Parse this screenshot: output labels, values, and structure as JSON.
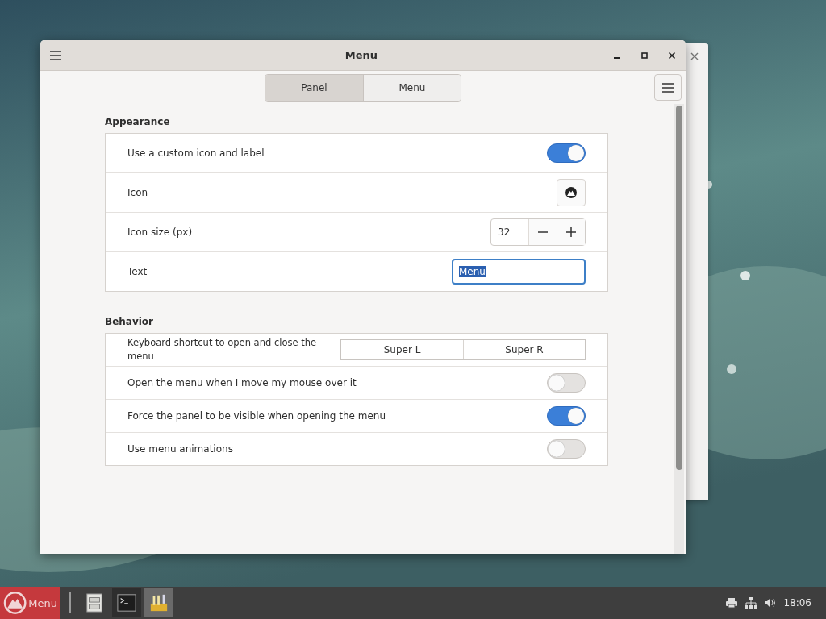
{
  "window": {
    "title": "Menu"
  },
  "tabs": [
    {
      "label": "Panel",
      "selected": true
    },
    {
      "label": "Menu",
      "selected": false
    }
  ],
  "sections": [
    {
      "title": "Appearance",
      "rows": [
        {
          "kind": "switch",
          "label": "Use a custom icon and label",
          "on": true
        },
        {
          "kind": "icon",
          "label": "Icon"
        },
        {
          "kind": "spin",
          "label": "Icon size (px)",
          "value": "32"
        },
        {
          "kind": "entry",
          "label": "Text",
          "value": "Menu",
          "text_selected": true
        }
      ]
    },
    {
      "title": "Behavior",
      "rows": [
        {
          "kind": "shortcut",
          "label": "Keyboard shortcut to open and close the menu",
          "keys": [
            "Super L",
            "Super R"
          ]
        },
        {
          "kind": "switch",
          "label": "Open the menu when I move my mouse over it",
          "on": false
        },
        {
          "kind": "switch",
          "label": "Force the panel to be visible when opening the menu",
          "on": true
        },
        {
          "kind": "switch",
          "label": "Use menu animations",
          "on": false
        }
      ]
    }
  ],
  "taskbar": {
    "menu_label": "Menu",
    "clock": "18:06"
  }
}
